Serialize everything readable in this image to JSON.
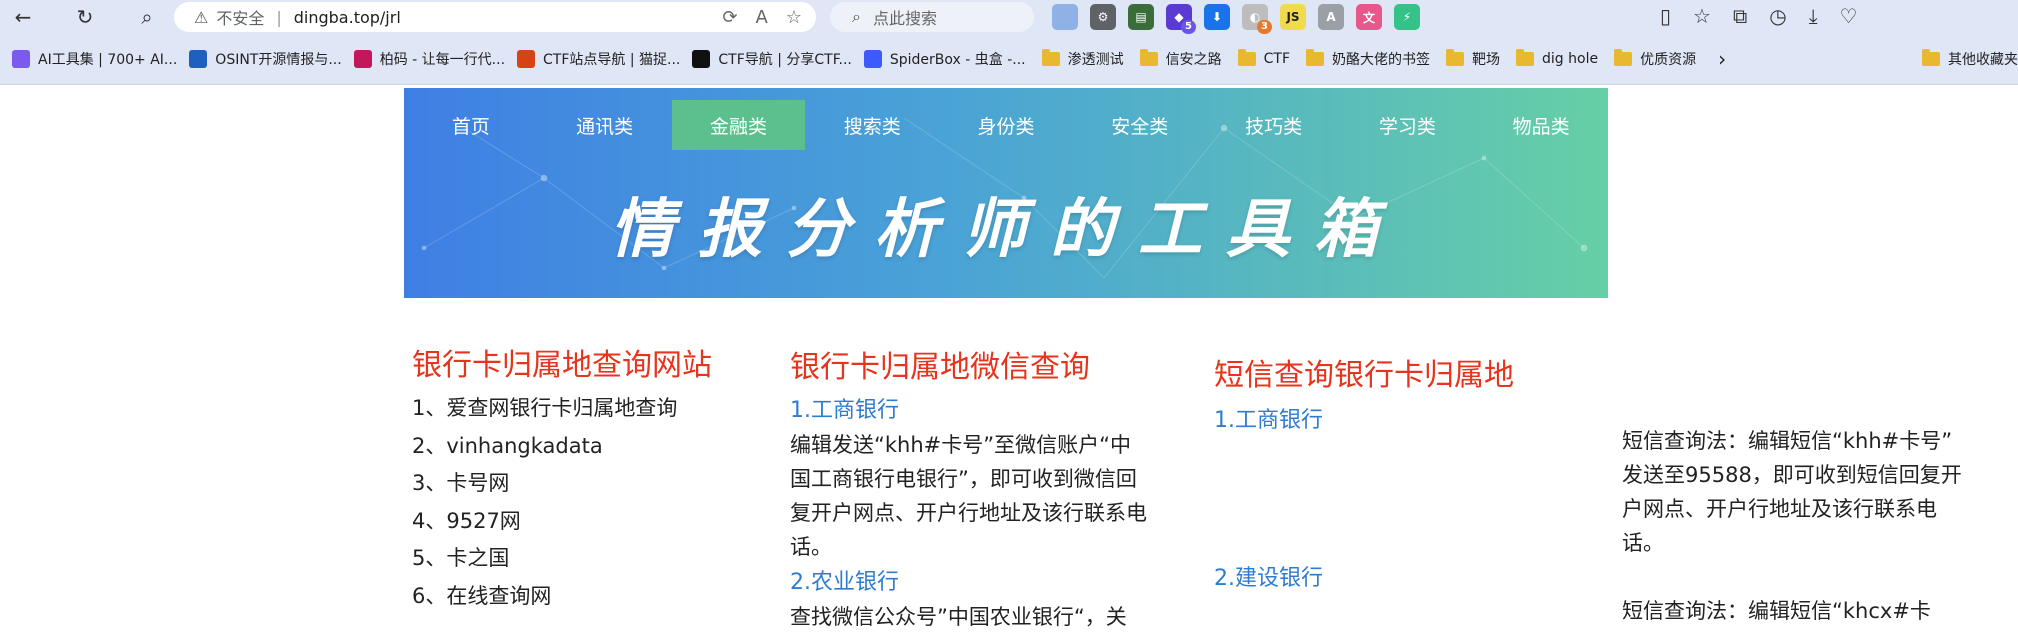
{
  "browser": {
    "insecure_label": "不安全",
    "url": "dingba.top/jrl",
    "search_placeholder": "点此搜索",
    "extensions": [
      {
        "name": "ext-1",
        "color": "#8fb1e6",
        "text": ""
      },
      {
        "name": "ext-2",
        "color": "#5f6368",
        "text": "⚙"
      },
      {
        "name": "ext-3",
        "color": "#3b6d3b",
        "text": "▤"
      },
      {
        "name": "ext-4",
        "color": "#5a3bd1",
        "text": "◆",
        "badge": "5"
      },
      {
        "name": "ext-5",
        "color": "#1a73e8",
        "text": "⬇"
      },
      {
        "name": "ext-6",
        "color": "#bdbdbd",
        "text": "◐",
        "badge": "3"
      },
      {
        "name": "ext-js",
        "color": "#f0db4f",
        "text": "JS"
      },
      {
        "name": "ext-8",
        "color": "#9aa0a6",
        "text": "A"
      },
      {
        "name": "ext-9",
        "color": "#e8578a",
        "text": "文"
      },
      {
        "name": "ext-10",
        "color": "#34c289",
        "text": "⚡"
      }
    ],
    "bookmarks": [
      {
        "label": "AI工具集 | 700+ AI...",
        "color": "#7a5af0"
      },
      {
        "label": "OSINT开源情报与...",
        "color": "#1e5fbf"
      },
      {
        "label": "柏码 - 让每一行代...",
        "color": "#c2185b"
      },
      {
        "label": "CTF站点导航 | 猫捉...",
        "color": "#d84315"
      },
      {
        "label": "CTF导航 | 分享CTF...",
        "color": "#111111"
      },
      {
        "label": "SpiderBox - 虫盒 -...",
        "color": "#3d5afe"
      }
    ],
    "folders": [
      "渗透测试",
      "信安之路",
      "CTF",
      "奶酪大佬的书签",
      "靶场",
      "dig hole",
      "优质资源"
    ],
    "other_bookmarks": "其他收藏夹"
  },
  "nav": {
    "items": [
      "首页",
      "通讯类",
      "金融类",
      "搜索类",
      "身份类",
      "安全类",
      "技巧类",
      "学习类",
      "物品类"
    ],
    "active_index": 2
  },
  "banner_title": "情报分析师的工具箱",
  "col1": {
    "title": "银行卡归属地查询网站",
    "items": [
      "1、爱查网银行卡归属地查询",
      "2、vinhangkadata",
      "3、卡号网",
      "4、9527网",
      "5、卡之国",
      "6、在线查询网"
    ]
  },
  "col2": {
    "title": "银行卡归属地微信查询",
    "sub1": "1.工商银行",
    "text1": [
      "编辑发送“khh#卡号”至微信账户“中",
      "国工商银行电银行”，即可收到微信回",
      "复开户网点、开户行地址及该行联系电",
      "话。"
    ],
    "sub2": "2.农业银行",
    "text2": "查找微信公众号”中国农业银行“，关"
  },
  "col3": {
    "title": "短信查询银行卡归属地",
    "sub1": "1.工商银行",
    "sub2": "2.建设银行"
  },
  "col4": {
    "text1": [
      "短信查询法：编辑短信“khh#卡号”",
      "发送至95588，即可收到短信回复开",
      "户网点、开户行地址及该行联系电",
      "话。"
    ],
    "text2": "短信查询法：编辑短信“khcx#卡"
  }
}
